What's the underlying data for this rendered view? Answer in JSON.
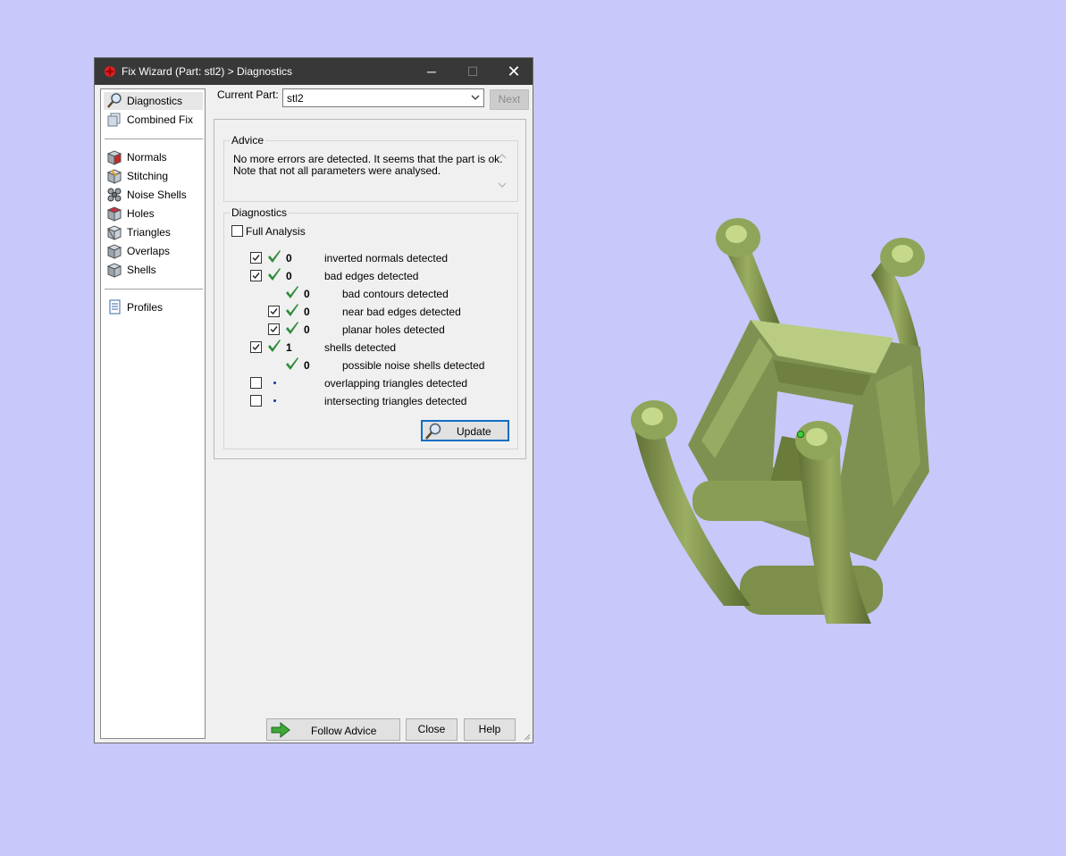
{
  "window": {
    "title": "Fix Wizard (Part: stl2) > Diagnostics",
    "minimize": "─",
    "maximize": "☐",
    "close": "✕"
  },
  "nav": {
    "top_items": [
      {
        "label": "Diagnostics",
        "icon": "magnifier-icon",
        "selected": true
      },
      {
        "label": "Combined Fix",
        "icon": "combined-fix-icon",
        "selected": false
      }
    ],
    "fix_items": [
      {
        "label": "Normals",
        "icon": "normals-cube-icon"
      },
      {
        "label": "Stitching",
        "icon": "stitching-cube-icon"
      },
      {
        "label": "Noise Shells",
        "icon": "noise-shells-icon"
      },
      {
        "label": "Holes",
        "icon": "holes-cube-icon"
      },
      {
        "label": "Triangles",
        "icon": "triangles-cube-icon"
      },
      {
        "label": "Overlaps",
        "icon": "overlaps-cube-icon"
      },
      {
        "label": "Shells",
        "icon": "shells-cube-icon"
      }
    ],
    "bottom_items": [
      {
        "label": "Profiles",
        "icon": "profiles-document-icon"
      }
    ]
  },
  "part": {
    "label": "Current Part:",
    "value": "stl2",
    "next_label": "Next"
  },
  "advice": {
    "title": "Advice",
    "line1": "No more errors are detected. It seems that the part is ok.",
    "line2": "Note that not all parameters were analysed."
  },
  "diagnostics": {
    "title": "Diagnostics",
    "full_analysis_label": "Full Analysis",
    "full_analysis_checked": false,
    "rows": [
      {
        "checkbox": true,
        "checked": true,
        "status": "ok",
        "count": "0",
        "label": "inverted normals detected",
        "indent": 0
      },
      {
        "checkbox": true,
        "checked": true,
        "status": "ok",
        "count": "0",
        "label": "bad edges detected",
        "indent": 0
      },
      {
        "checkbox": false,
        "checked": false,
        "status": "ok",
        "count": "0",
        "label": "bad contours detected",
        "indent": 1
      },
      {
        "checkbox": true,
        "checked": true,
        "status": "ok",
        "count": "0",
        "label": "near bad edges detected",
        "indent": 1
      },
      {
        "checkbox": true,
        "checked": true,
        "status": "ok",
        "count": "0",
        "label": "planar holes detected",
        "indent": 1
      },
      {
        "checkbox": true,
        "checked": true,
        "status": "ok",
        "count": "1",
        "label": "shells detected",
        "indent": 0
      },
      {
        "checkbox": false,
        "checked": false,
        "status": "ok",
        "count": "0",
        "label": "possible noise shells detected",
        "indent": 1
      },
      {
        "checkbox": true,
        "checked": false,
        "status": "none",
        "count": "",
        "label": "overlapping triangles detected",
        "indent": 0
      },
      {
        "checkbox": true,
        "checked": false,
        "status": "none",
        "count": "",
        "label": "intersecting triangles detected",
        "indent": 0
      }
    ],
    "update_label": "Update"
  },
  "footer": {
    "follow_advice_label": "Follow Advice",
    "close_label": "Close",
    "help_label": "Help"
  },
  "colors": {
    "background": "#c8c8fb",
    "titlebar": "#383838",
    "check_green": "#2e8b3a",
    "model_green": "#7f9150"
  }
}
